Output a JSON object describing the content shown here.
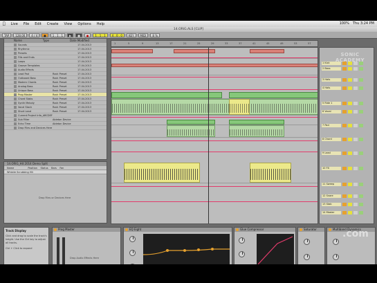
{
  "menubar": {
    "app": "Live",
    "items": [
      "File",
      "Edit",
      "Create",
      "View",
      "Options",
      "Help"
    ],
    "status": [
      "100%",
      "Thu 3:24 PM"
    ]
  },
  "window": {
    "title": "14.ORIG.ALS  [CLIP]"
  },
  "transport": {
    "tempo": "128.00",
    "signature": "4 / 4",
    "position": "1 . 1 . 1",
    "loop_start": "1 . 1 . 1",
    "loop_len": "4 . 0 . 0",
    "key": "KEY",
    "midi": "MIDI",
    "cpu": "8 %"
  },
  "browser": {
    "columns": [
      "Name",
      "Type",
      "Date Modified"
    ],
    "rows": [
      {
        "name": "Sounds",
        "type": "",
        "date": "17.04.2013"
      },
      {
        "name": "Rhythmic",
        "type": "",
        "date": "17.04.2013"
      },
      {
        "name": "Presets",
        "type": "",
        "date": "17.04.2013"
      },
      {
        "name": "Fills and Ends",
        "type": "",
        "date": "17.04.2013"
      },
      {
        "name": "Loops",
        "type": "",
        "date": "17.04.2013"
      },
      {
        "name": "Groove Templates",
        "type": "",
        "date": "17.04.2013"
      },
      {
        "name": "Audio Effects",
        "type": "",
        "date": "17.04.2013"
      },
      {
        "name": "Lead Pad",
        "type": "Rack Preset",
        "date": "17.04.2013"
      },
      {
        "name": "Outboard Bass",
        "type": "Rack Preset",
        "date": "17.04.2013"
      },
      {
        "name": "Modern Chords",
        "type": "Rack Preset",
        "date": "17.04.2013"
      },
      {
        "name": "Analog Bass",
        "type": "Rack Preset",
        "date": "17.04.2013"
      },
      {
        "name": "Unique Bass",
        "type": "Rack Preset",
        "date": "17.04.2013"
      },
      {
        "name": "Prog Master",
        "type": "Rack Preset",
        "date": "17.04.2013"
      },
      {
        "name": "Chord Stabs",
        "type": "Rack Preset",
        "date": "17.04.2013"
      },
      {
        "name": "Synth Melody",
        "type": "Rack Preset",
        "date": "17.04.2013"
      },
      {
        "name": "Vocal Stack",
        "type": "Rack Preset",
        "date": "17.04.2013"
      },
      {
        "name": "Short Lead",
        "type": "Rack Preset",
        "date": "17.04.2013"
      },
      {
        "name": "Current Project Info_ABCDEF",
        "type": "",
        "date": ""
      },
      {
        "name": "Sub Filter",
        "type": "Ableton Device",
        "date": ""
      },
      {
        "name": "Echo Time",
        "type": "Ableton Device",
        "date": ""
      },
      {
        "name": "Drop Files and Devices Here",
        "type": "",
        "date": ""
      }
    ]
  },
  "clip_view": {
    "header": "14.ORIG_Hit 2014 Demo Split",
    "columns": [
      "Name",
      "Position",
      "Status",
      "Bars",
      "Fan"
    ],
    "row": "Whistle Scrubbing Hit",
    "drop_hint": "Drop Files or Devices Here"
  },
  "ruler": {
    "ticks": [
      "1",
      "5",
      "9",
      "13",
      "17",
      "21",
      "25",
      "29",
      "33",
      "37",
      "41",
      "45",
      "49",
      "53",
      "57"
    ]
  },
  "mixer": {
    "tracks": [
      "1 Kick",
      "2 Bass",
      "3 Hats",
      "4 Hats",
      "5 Ride 1",
      "6 Vocal",
      "7 Pad",
      "8 Chord",
      "9 Lead",
      "10 FX",
      "11 Sweep",
      "12 Snare",
      "13 Stab",
      "14 Master"
    ]
  },
  "watermark": {
    "logo_top": "SONIC",
    "logo_bottom": "ACADEMY",
    "com": ".com"
  },
  "info_view": {
    "title": "Track Display",
    "text": "Click and drag to scale the track's height. Use the Ctrl key to adjust all tracks.",
    "hint": "Ctrl + Click to expand"
  },
  "devices": [
    {
      "name": "Prog Master",
      "body": "Drop Audio Effects Here"
    },
    {
      "name": "EQ Eight",
      "body": ""
    },
    {
      "name": "Glue Compressor",
      "body": ""
    },
    {
      "name": "Saturator",
      "body": ""
    },
    {
      "name": "Multiband Dynamics",
      "body": ""
    }
  ]
}
